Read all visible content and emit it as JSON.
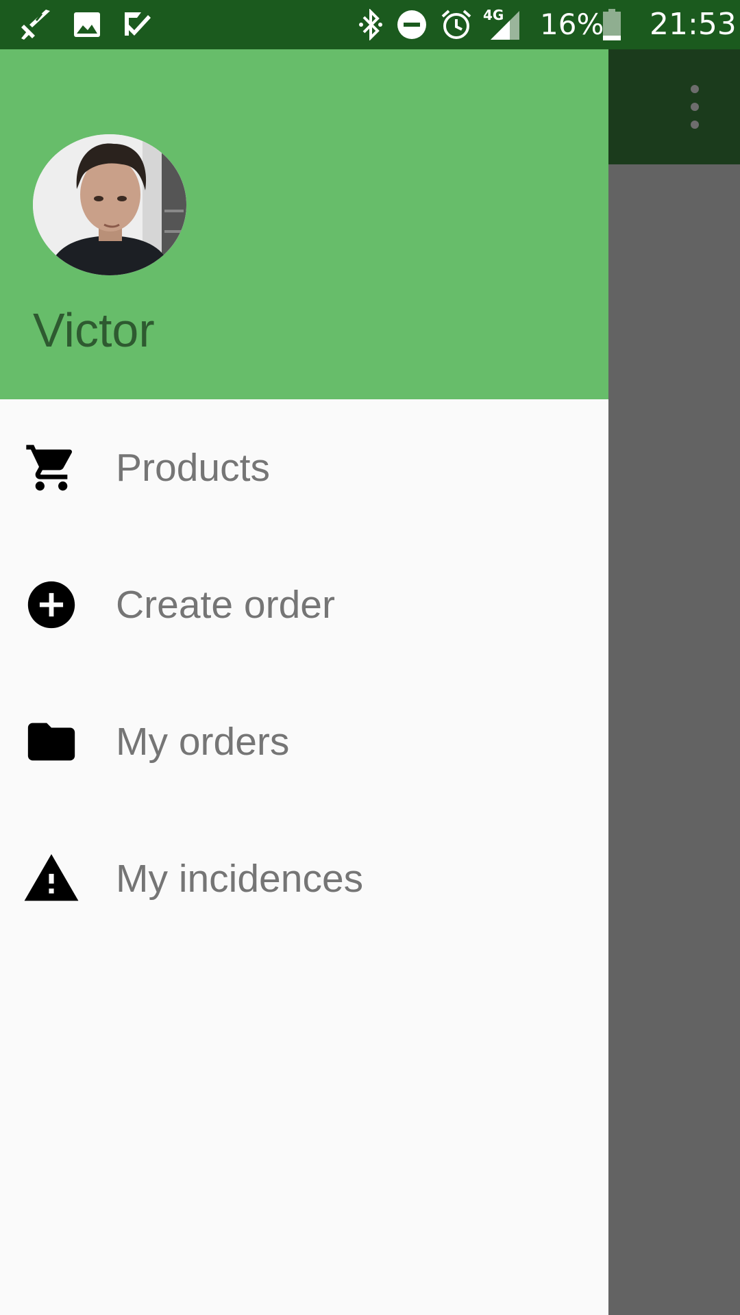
{
  "status_bar": {
    "left_icons": [
      "sword-app-icon",
      "image-notification-icon",
      "task-done-icon"
    ],
    "right_icons": [
      "bluetooth-icon",
      "do-not-disturb-icon",
      "alarm-icon",
      "cellular-signal-icon",
      "battery-icon"
    ],
    "network_label": "4G",
    "battery_percent": "16%",
    "time": "21:53"
  },
  "colors": {
    "status_bar": "#1b5a1e",
    "header": "#67bd6a",
    "toolbar": "#1b3b1c",
    "scrim": "#636363",
    "drawer_bg": "#fafafa",
    "menu_text": "#757575",
    "name_text": "#2e5a30"
  },
  "drawer": {
    "user_name": "Victor",
    "avatar_icon": "user-photo-avatar",
    "menu_items": [
      {
        "label": "Products",
        "icon": "shopping-cart-icon"
      },
      {
        "label": "Create order",
        "icon": "add-circle-icon"
      },
      {
        "label": "My orders",
        "icon": "folder-icon"
      },
      {
        "label": "My incidences",
        "icon": "warning-icon"
      }
    ]
  },
  "toolbar": {
    "overflow_icon": "more-vert-icon"
  }
}
